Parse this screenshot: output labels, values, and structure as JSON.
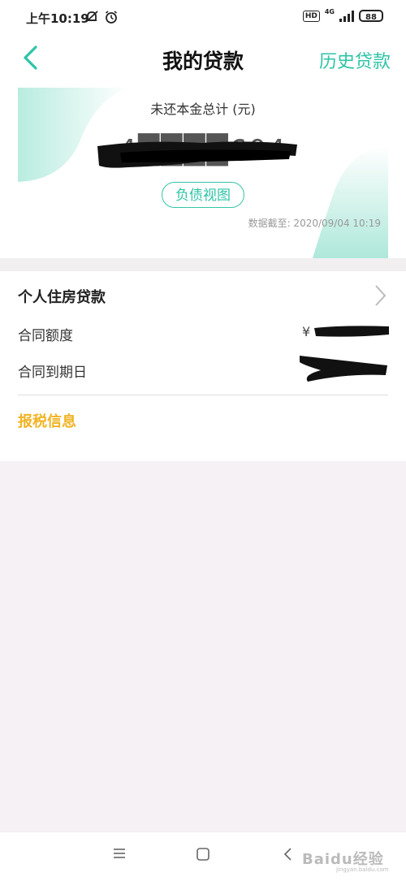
{
  "status_bar": {
    "time": "上午10:19",
    "hd": "HD",
    "network": "4G",
    "battery": "88"
  },
  "nav": {
    "title": "我的贷款",
    "history_link": "历史贷款"
  },
  "summary": {
    "title": "未还本金总计 (元)",
    "amount": "4████604",
    "amount_redacted": true,
    "debt_view_button": "负债视图",
    "data_time": "数据截至: 2020/09/04 10:19"
  },
  "loan": {
    "title": "个人住房贷款",
    "contract_amount_label": "合同额度",
    "contract_amount_currency": "¥",
    "due_date_label": "合同到期日",
    "tax_info_link": "报税信息"
  },
  "colors": {
    "accent": "#2ec4a6",
    "tax_link": "#f1b323",
    "page_bg": "#f6f1f4"
  },
  "watermark": {
    "brand": "Baidu经验",
    "sub": "jingyan.baidu.com"
  }
}
